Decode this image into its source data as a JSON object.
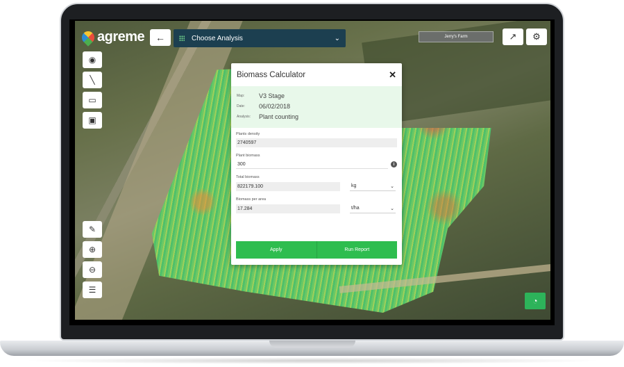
{
  "app": {
    "logo_text": "agreme",
    "analysis_select": "Choose Analysis",
    "farm_select": "Jerry's Farm",
    "icons": {
      "back": "arrow-left-icon",
      "share": "share-icon",
      "settings": "gear-icon",
      "pin": "map-pin-icon",
      "line": "line-tool-icon",
      "polygon": "polygon-tool-icon",
      "area": "area-tool-icon",
      "layer_edit": "layer-edit-icon",
      "zoom_in": "zoom-in-icon",
      "zoom_out": "zoom-out-icon",
      "layers": "layers-icon",
      "chart": "pie-chart-icon"
    }
  },
  "modal": {
    "title": "Biomass Calculator",
    "info": {
      "map_label": "Map:",
      "map_value": "V3 Stage",
      "date_label": "Date:",
      "date_value": "06/02/2018",
      "analysis_label": "Analysis:",
      "analysis_value": "Plant counting"
    },
    "fields": {
      "plants_density_label": "Plants density",
      "plants_density_value": "2740597",
      "plant_biomass_label": "Plant biomass",
      "plant_biomass_value": "300",
      "total_biomass_label": "Total biomass",
      "total_biomass_value": "822179.100",
      "total_biomass_unit": "kg",
      "biomass_per_area_label": "Biomass per area",
      "biomass_per_area_value": "17.284",
      "biomass_per_area_unit": "t/ha"
    },
    "buttons": {
      "apply": "Apply",
      "run_report": "Run Report"
    }
  },
  "colors": {
    "accent_green": "#2ebd4f",
    "header_navy": "#1c3f50",
    "info_bg": "#e8f8ea"
  }
}
